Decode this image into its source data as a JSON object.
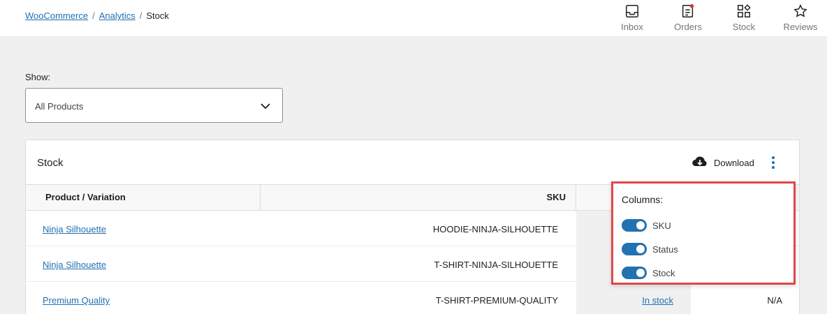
{
  "breadcrumb": {
    "items": [
      "WooCommerce",
      "Analytics"
    ],
    "current": "Stock",
    "separator": "/"
  },
  "activity_bar": [
    {
      "label": "Inbox",
      "icon": "inbox-icon"
    },
    {
      "label": "Orders",
      "icon": "orders-icon",
      "has_notification": true
    },
    {
      "label": "Stock",
      "icon": "stock-icon"
    },
    {
      "label": "Reviews",
      "icon": "star-icon"
    }
  ],
  "filter": {
    "label": "Show:",
    "value": "All Products"
  },
  "report": {
    "title": "Stock",
    "download_label": "Download",
    "columns": {
      "product": "Product / Variation",
      "sku": "SKU"
    },
    "rows": [
      {
        "product": "Ninja Silhouette",
        "sku": "HOODIE-NINJA-SILHOUETTE",
        "status": "",
        "stock": ""
      },
      {
        "product": "Ninja Silhouette",
        "sku": "T-SHIRT-NINJA-SILHOUETTE",
        "status": "",
        "stock": ""
      },
      {
        "product": "Premium Quality",
        "sku": "T-SHIRT-PREMIUM-QUALITY",
        "status": "In stock",
        "stock": "N/A"
      }
    ]
  },
  "columns_popover": {
    "title": "Columns:",
    "options": [
      {
        "label": "SKU",
        "enabled": true
      },
      {
        "label": "Status",
        "enabled": true
      },
      {
        "label": "Stock",
        "enabled": true
      }
    ]
  },
  "colors": {
    "accent": "#2271b1",
    "highlight_border": "#e0474c",
    "notification": "#d63638"
  }
}
